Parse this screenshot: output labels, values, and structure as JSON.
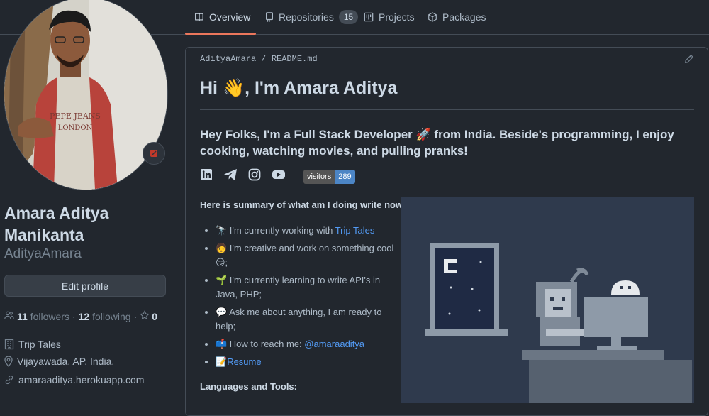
{
  "nav": {
    "tabs": [
      {
        "label": "Overview",
        "icon": "book-icon"
      },
      {
        "label": "Repositories",
        "icon": "repo-icon",
        "count": "15"
      },
      {
        "label": "Projects",
        "icon": "project-icon"
      },
      {
        "label": "Packages",
        "icon": "package-icon"
      }
    ],
    "active_tab": "Overview",
    "accent": "#ec775c"
  },
  "profile": {
    "full_name": "Amara Aditya Manikanta",
    "username": "AdityaAmara",
    "edit_button": "Edit profile",
    "followers_count": "11",
    "followers_label": "followers",
    "separator": "·",
    "following_count": "12",
    "following_label": "following",
    "stars_count": "0",
    "organization": "Trip Tales",
    "location": "Vijayawada, AP, India.",
    "website": "amaraaditya.herokuapp.com"
  },
  "readme": {
    "owner": "AdityaAmara",
    "slash": "/",
    "file": "README.md",
    "heading": "Hi 👋, I'm Amara Aditya",
    "intro": "Hey Folks, I'm a Full Stack Developer 🚀 from India. Beside's programming, I enjoy cooking, watching movies, and pulling pranks!",
    "badge_label": "visitors",
    "badge_value": "289",
    "summary_title": "Here is summary of what am I doing write now !!",
    "bullets": {
      "working_prefix": "🔭 I'm currently working with ",
      "working_link": "Trip Tales",
      "creative": "🧑 I'm creative and work on something cool 😏;",
      "learning": "🌱 I'm currently learning to write API's in Java, PHP;",
      "ask": "💬 Ask me about anything, I am ready to help;",
      "reach_prefix": "📫 How to reach me: ",
      "reach_link": "@amaraaditya",
      "resume_prefix": "📝",
      "resume_link": "Resume"
    },
    "languages_title": "Languages and Tools:"
  }
}
